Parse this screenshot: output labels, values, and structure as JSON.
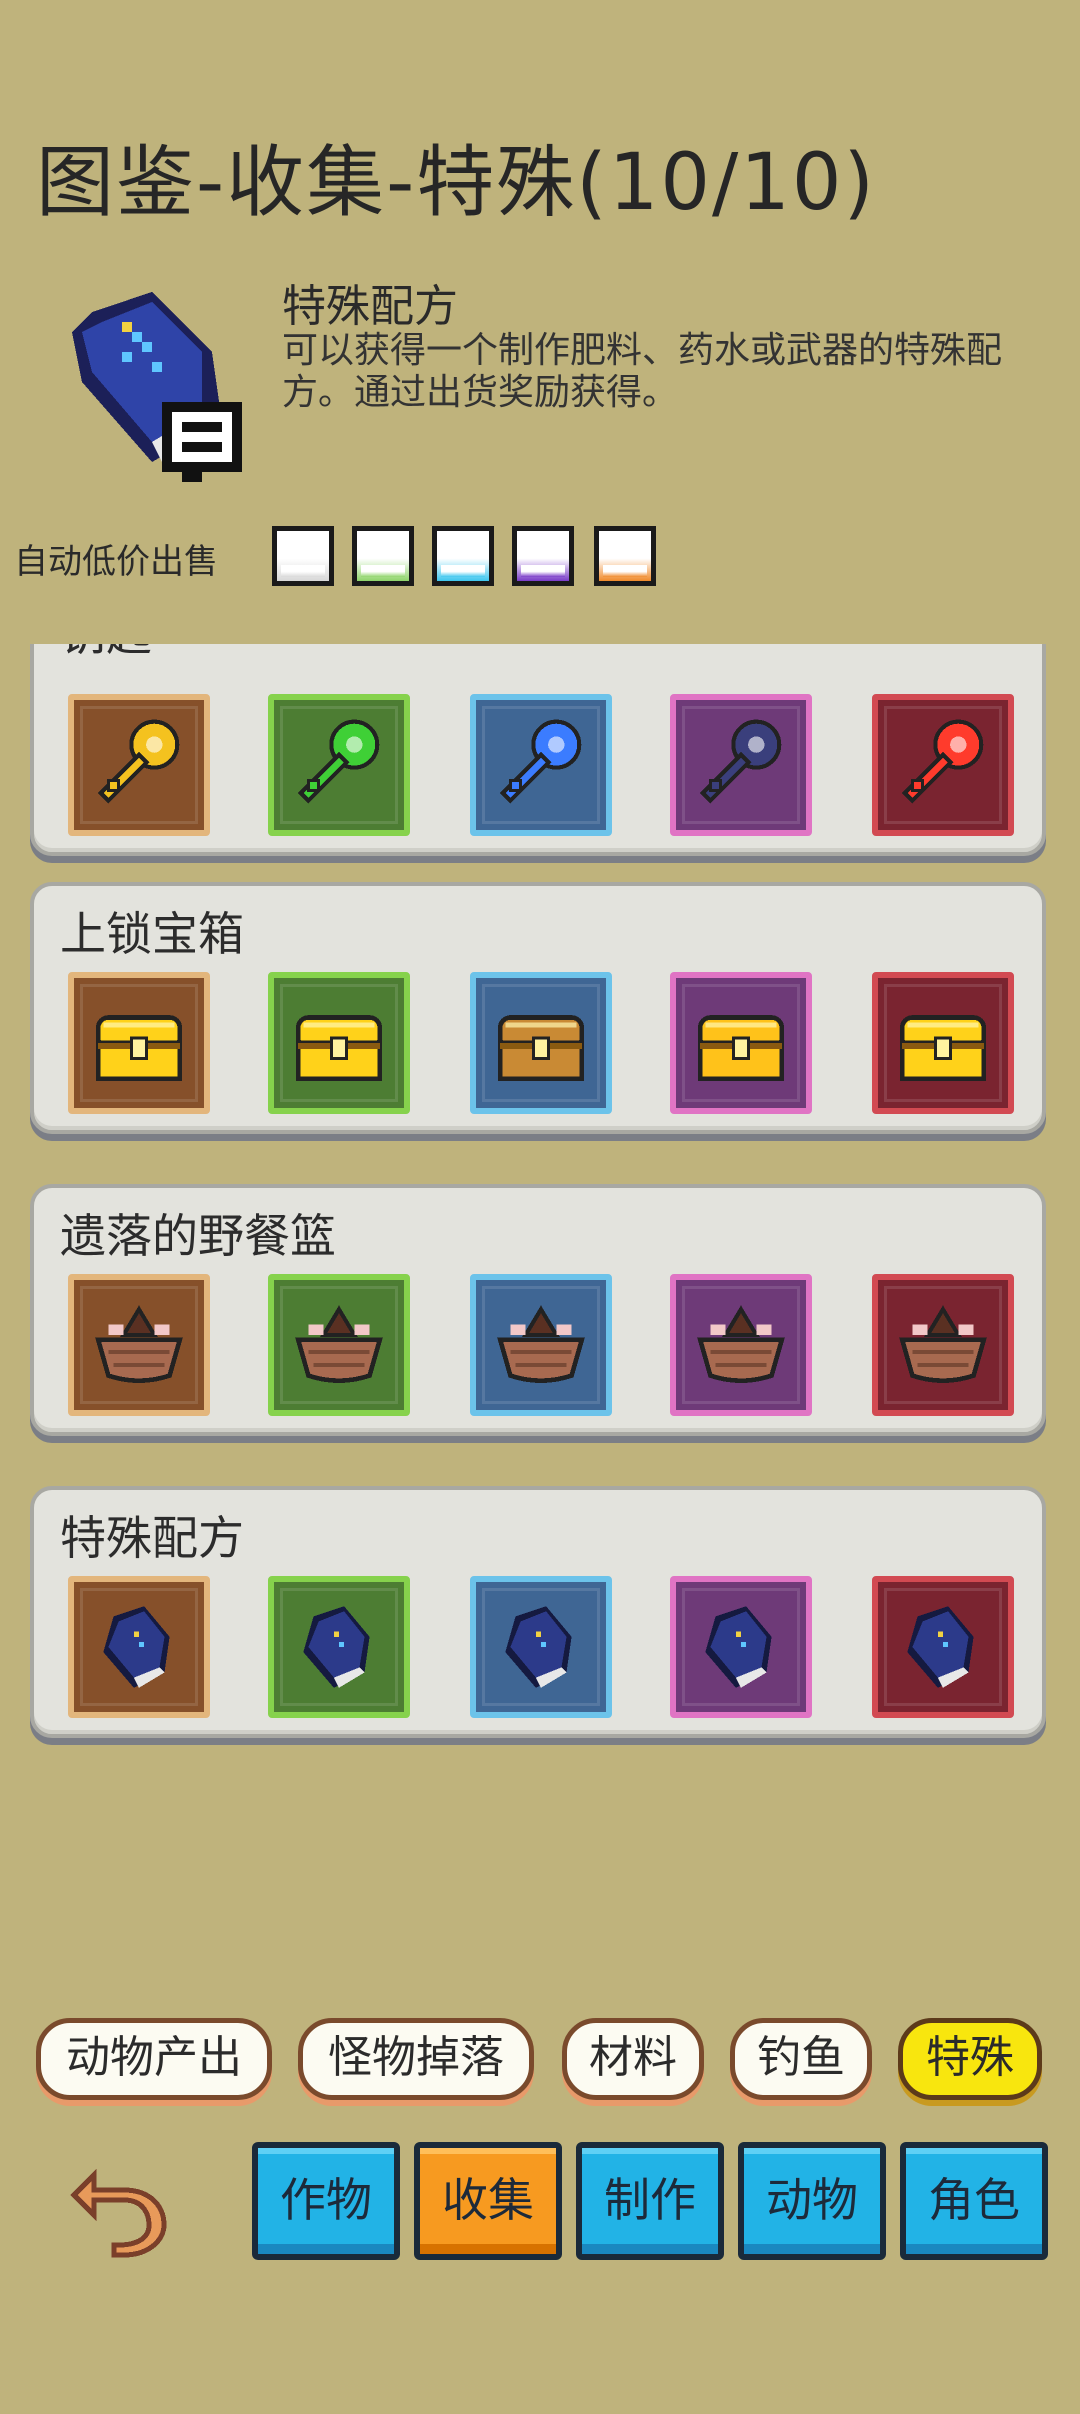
{
  "header": {
    "title": "图鉴-收集-特殊(10/10)"
  },
  "selected_item": {
    "name": "特殊配方",
    "description": "可以获得一个制作肥料、药水或武器的特殊配方。通过出货奖励获得。",
    "icon": "blue-recipe-book-icon"
  },
  "auto_sell": {
    "label": "自动低价出售",
    "tiers": [
      {
        "name": "white",
        "color": "#ffffff",
        "accent": "#d8d8d8"
      },
      {
        "name": "green",
        "color": "#ffffff",
        "accent": "#8fd46a"
      },
      {
        "name": "blue",
        "color": "#ffffff",
        "accent": "#3ec6ee"
      },
      {
        "name": "purple",
        "color": "#ffffff",
        "accent": "#7a3cc8"
      },
      {
        "name": "orange",
        "color": "#ffffff",
        "accent": "#f08a2a"
      }
    ]
  },
  "rarity_colors": {
    "brown": {
      "fill": "#86502a",
      "border": "#e3b67c"
    },
    "green": {
      "fill": "#4d7d33",
      "border": "#86d24c"
    },
    "blue": {
      "fill": "#3f6694",
      "border": "#6cc3ea"
    },
    "purple": {
      "fill": "#6e3a78",
      "border": "#e074c4"
    },
    "red": {
      "fill": "#7a2430",
      "border": "#d24a52"
    }
  },
  "collections": [
    {
      "label": "钥匙",
      "icon": "key-icon",
      "colors": [
        "#f4c21f",
        "#3fd036",
        "#3b7cff",
        "#3a3f7c",
        "#ff3b2c"
      ]
    },
    {
      "label": "上锁宝箱",
      "icon": "treasure-chest-icon",
      "colors": [
        "#ffd21a",
        "#ffd21a",
        "#c98a34",
        "#ffc21a",
        "#ffd21a"
      ]
    },
    {
      "label": "遗落的野餐篮",
      "icon": "picnic-basket-icon",
      "colors": [
        "#a86a50",
        "#a86a50",
        "#a86a50",
        "#a86a50",
        "#a86a50"
      ]
    },
    {
      "label": "特殊配方",
      "icon": "recipe-book-icon",
      "colors": [
        "#2c3a8a",
        "#2c3a8a",
        "#2c3a8a",
        "#2c3a8a",
        "#2c3a8a"
      ]
    }
  ],
  "sub_tabs": [
    "动物产出",
    "怪物掉落",
    "材料",
    "钓鱼",
    "特殊"
  ],
  "active_sub_tab": "特殊",
  "main_tabs": [
    "作物",
    "收集",
    "制作",
    "动物",
    "角色"
  ],
  "active_main_tab": "收集"
}
